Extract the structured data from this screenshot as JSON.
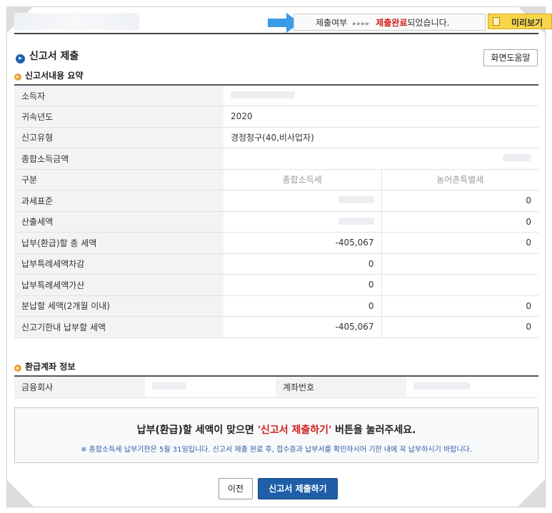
{
  "topbar": {
    "status_label": "제출여부",
    "status_arrows": "▸▸▸▸",
    "status_done": "제출완료",
    "status_suffix": "되었습니다.",
    "preview_label": "미리보기"
  },
  "header": {
    "title": "신고서 제출",
    "help_label": "화면도움말"
  },
  "summary": {
    "section_title": "신고서내용 요약",
    "rows_top": [
      {
        "label": "소득자",
        "value": ""
      },
      {
        "label": "귀속년도",
        "value": "2020"
      },
      {
        "label": "신고유형",
        "value": "경정청구(40,비사업자)"
      },
      {
        "label": "종합소득금액",
        "value": ""
      }
    ],
    "col_header": {
      "label": "구분",
      "col1": "종합소득세",
      "col2": "농어촌특별세"
    },
    "rows_tax": [
      {
        "label": "과세표준",
        "v1": "",
        "v2": "0"
      },
      {
        "label": "산출세액",
        "v1": "",
        "v2": "0"
      },
      {
        "label": "납부(환급)할 총 세액",
        "v1": "-405,067",
        "v2": "0"
      },
      {
        "label": "납부특례세액차감",
        "v1": "0",
        "v2": ""
      },
      {
        "label": "납부특례세액가산",
        "v1": "0",
        "v2": ""
      },
      {
        "label": "분납할 세액(2개월 이내)",
        "v1": "0",
        "v2": "0"
      },
      {
        "label": "신고기한내 납부할 세액",
        "v1": "-405,067",
        "v2": "0"
      }
    ]
  },
  "account": {
    "section_title": "환급계좌 정보",
    "bank_label": "금융회사",
    "account_label": "계좌번호"
  },
  "notice": {
    "main_prefix": "납부(환급)할 세액이 맞으면 ",
    "main_highlight": "'신고서 제출하기'",
    "main_suffix": " 버튼을 눌러주세요.",
    "sub": "※ 종합소득세 납부기한은 5월 31일입니다. 신고서 제출 완료 후, 접수증과 납부서를 확인하시어 기한 내에 꼭 납부하시기 바랍니다."
  },
  "buttons": {
    "prev_label": "이전",
    "submit_label": "신고서 제출하기"
  },
  "colors": {
    "accent_blue": "#1f5fa8",
    "highlight_red": "#d0201f",
    "preview_yellow": "#f7d548"
  }
}
